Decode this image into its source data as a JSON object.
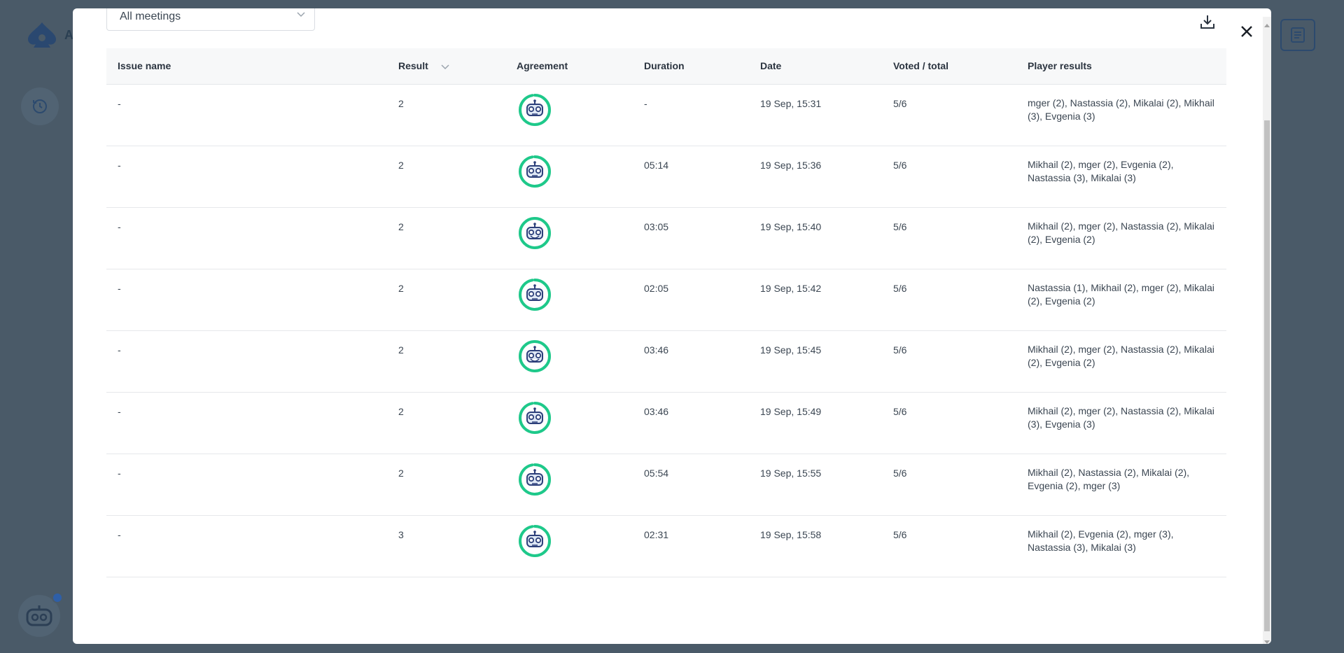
{
  "background": {
    "logo_icon": "spade-logo-icon",
    "logo_text": "A",
    "history_icon": "history-icon",
    "notes_icon": "notes-icon",
    "bot_icon": "bot-icon"
  },
  "modal": {
    "meeting_filter": {
      "selected": "All meetings",
      "icon": "chevron-down-icon"
    },
    "download_icon": "download-icon",
    "close_icon": "close-icon",
    "table": {
      "columns": {
        "issue_name": "Issue name",
        "result": "Result",
        "agreement": "Agreement",
        "duration": "Duration",
        "date": "Date",
        "voted_total": "Voted / total",
        "player_results": "Player results"
      },
      "rows": [
        {
          "issue": "-",
          "result": "2",
          "agreement": 0.97,
          "face": "neutral",
          "duration": "-",
          "date": "19 Sep, 15:31",
          "voted": "5/6",
          "players": "mger (2), Nastassia (2), Mikalai (2), Mikhail (3), Evgenia (3)"
        },
        {
          "issue": "-",
          "result": "2",
          "agreement": 0.97,
          "face": "neutral",
          "duration": "05:14",
          "date": "19 Sep, 15:36",
          "voted": "5/6",
          "players": "Mikhail (2), mger (2), Evgenia (2), Nastassia (3), Mikalai (3)"
        },
        {
          "issue": "-",
          "result": "2",
          "agreement": 1.0,
          "face": "happy",
          "duration": "03:05",
          "date": "19 Sep, 15:40",
          "voted": "5/6",
          "players": "Mikhail (2), mger (2), Nastassia (2), Mikalai (2), Evgenia (2)"
        },
        {
          "issue": "-",
          "result": "2",
          "agreement": 0.97,
          "face": "neutral",
          "duration": "02:05",
          "date": "19 Sep, 15:42",
          "voted": "5/6",
          "players": "Nastassia (1), Mikhail (2), mger (2), Mikalai (2), Evgenia (2)"
        },
        {
          "issue": "-",
          "result": "2",
          "agreement": 1.0,
          "face": "happy",
          "duration": "03:46",
          "date": "19 Sep, 15:45",
          "voted": "5/6",
          "players": "Mikhail (2), mger (2), Nastassia (2), Mikalai (2), Evgenia (2)"
        },
        {
          "issue": "-",
          "result": "2",
          "agreement": 0.97,
          "face": "neutral",
          "duration": "03:46",
          "date": "19 Sep, 15:49",
          "voted": "5/6",
          "players": "Mikhail (2), mger (2), Nastassia (2), Mikalai (3), Evgenia (3)"
        },
        {
          "issue": "-",
          "result": "2",
          "agreement": 0.97,
          "face": "neutral",
          "duration": "05:54",
          "date": "19 Sep, 15:55",
          "voted": "5/6",
          "players": "Mikhail (2), Nastassia (2), Mikalai (2), Evgenia (2), mger (3)"
        },
        {
          "issue": "-",
          "result": "3",
          "agreement": 0.97,
          "face": "neutral",
          "duration": "02:31",
          "date": "19 Sep, 15:58",
          "voted": "5/6",
          "players": "Mikhail (2), Evgenia (2), mger (3), Nastassia (3), Mikalai (3)"
        }
      ]
    }
  },
  "colors": {
    "agreement_ring": "#1ec98a",
    "ring_track": "#e6e8ea",
    "bot_blue": "#2c3f7a",
    "overlay": "#4a5a68"
  }
}
